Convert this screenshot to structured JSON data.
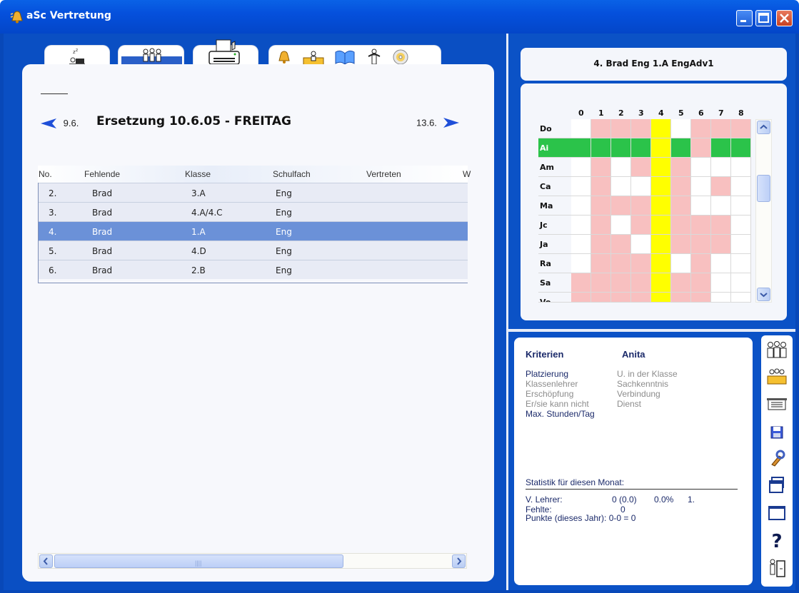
{
  "window": {
    "title": "aSc Vertretung"
  },
  "navigation": {
    "prev_date": "9.6.",
    "title": "Ersetzung 10.6.05 - FREITAG",
    "next_date": "13.6."
  },
  "table": {
    "headers": [
      "No.",
      "Fehlende",
      "Klasse",
      "Schulfach",
      "Vertreten",
      "W"
    ],
    "rows": [
      {
        "no": "2.",
        "absent": "Brad",
        "class": "3.A",
        "subject": "Eng",
        "substitute": ""
      },
      {
        "no": "3.",
        "absent": "Brad",
        "class": "4.A/4.C",
        "subject": "Eng",
        "substitute": ""
      },
      {
        "no": "4.",
        "absent": "Brad",
        "class": "1.A",
        "subject": "Eng",
        "substitute": "",
        "selected": true
      },
      {
        "no": "5.",
        "absent": "Brad",
        "class": "4.D",
        "subject": "Eng",
        "substitute": ""
      },
      {
        "no": "6.",
        "absent": "Brad",
        "class": "2.B",
        "subject": "Eng",
        "substitute": ""
      }
    ]
  },
  "schedule": {
    "header": "4. Brad Eng 1.A EngAdv1",
    "periods": [
      "0",
      "1",
      "2",
      "3",
      "4",
      "5",
      "6",
      "7",
      "8"
    ],
    "teachers": [
      "Do",
      "Ai",
      "Am",
      "Ca",
      "Ma",
      "Jc",
      "Ja",
      "Ra",
      "Sa",
      "Vo"
    ],
    "selected_teacher": "Ai",
    "busy": [
      [
        0,
        1,
        1,
        1,
        2,
        0,
        1,
        1,
        1
      ],
      [
        3,
        3,
        3,
        3,
        2,
        3,
        1,
        3,
        3
      ],
      [
        0,
        1,
        0,
        1,
        2,
        1,
        0,
        0,
        0
      ],
      [
        0,
        1,
        0,
        0,
        2,
        1,
        0,
        1,
        0
      ],
      [
        0,
        1,
        1,
        1,
        2,
        1,
        0,
        0,
        0
      ],
      [
        0,
        1,
        0,
        1,
        2,
        1,
        1,
        1,
        0
      ],
      [
        0,
        1,
        1,
        0,
        2,
        1,
        1,
        1,
        0
      ],
      [
        0,
        1,
        1,
        1,
        2,
        0,
        1,
        0,
        0
      ],
      [
        1,
        1,
        1,
        1,
        2,
        1,
        1,
        0,
        0
      ],
      [
        1,
        1,
        1,
        1,
        2,
        1,
        1,
        0,
        0
      ]
    ],
    "colors": {
      "busy": "#f8c0c0",
      "free": "#ffffff",
      "selected_period": "#ffff00",
      "selected_row": "#2bc34a"
    }
  },
  "criteria": {
    "header": "Kriterien",
    "teacher": "Anita",
    "left": [
      {
        "label": "Platzierung",
        "active": true
      },
      {
        "label": "Klassenlehrer",
        "active": false
      },
      {
        "label": "Erschöpfung",
        "active": false
      },
      {
        "label": "Er/sie kann nicht",
        "active": false
      },
      {
        "label": "Max. Stunden/Tag",
        "active": true
      }
    ],
    "right": [
      {
        "label": "U. in der Klasse",
        "active": false
      },
      {
        "label": "Sachkenntnis",
        "active": false
      },
      {
        "label": "Verbindung",
        "active": false
      },
      {
        "label": "Dienst",
        "active": false
      }
    ],
    "stats_title": "Statistik für diesen Monat:",
    "stats": {
      "v_label": "V. Lehrer:",
      "v_value": "0 (0.0)",
      "v_pct": "0.0%",
      "v_rank": "1.",
      "absent_label": "Fehlte:",
      "absent_value": "0",
      "points": "Punkte (dieses Jahr): 0-0 = 0"
    }
  },
  "toolbar": {
    "icons": [
      "teachers-icon",
      "classes-icon",
      "classrooms-icon",
      "save-icon",
      "tools-icon",
      "windows-icon",
      "window-icon",
      "help-icon",
      "exit-icon"
    ]
  }
}
